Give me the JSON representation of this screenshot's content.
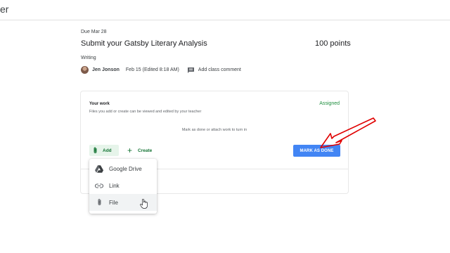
{
  "topbar": {
    "fragment": "er"
  },
  "assignment": {
    "due": "Due Mar 28",
    "title": "Submit your Gatsby Literary Analysis",
    "points": "100 points",
    "topic": "Writing",
    "author": "Jen Jonson",
    "date": "Feb 15 (Edited 8:18 AM)",
    "comment_label": "Add class comment"
  },
  "work": {
    "heading": "Your work",
    "status": "Assigned",
    "description": "Files you add or create can be viewed and edited by your teacher",
    "hint": "Mark as done or attach work to turn in",
    "add_label": "Add",
    "create_label": "Create",
    "mark_done_label": "MARK AS DONE"
  },
  "add_menu": {
    "items": [
      {
        "label": "Google Drive",
        "icon": "google-drive-icon"
      },
      {
        "label": "Link",
        "icon": "link-icon"
      },
      {
        "label": "File",
        "icon": "paperclip-icon"
      }
    ],
    "highlighted_item": "File"
  },
  "colors": {
    "accent_green": "#137333",
    "add_button_bg": "#e6f4ea",
    "status_green": "#1e8e3e",
    "primary_blue": "#4285f4",
    "annotation_red": "#e00000"
  }
}
